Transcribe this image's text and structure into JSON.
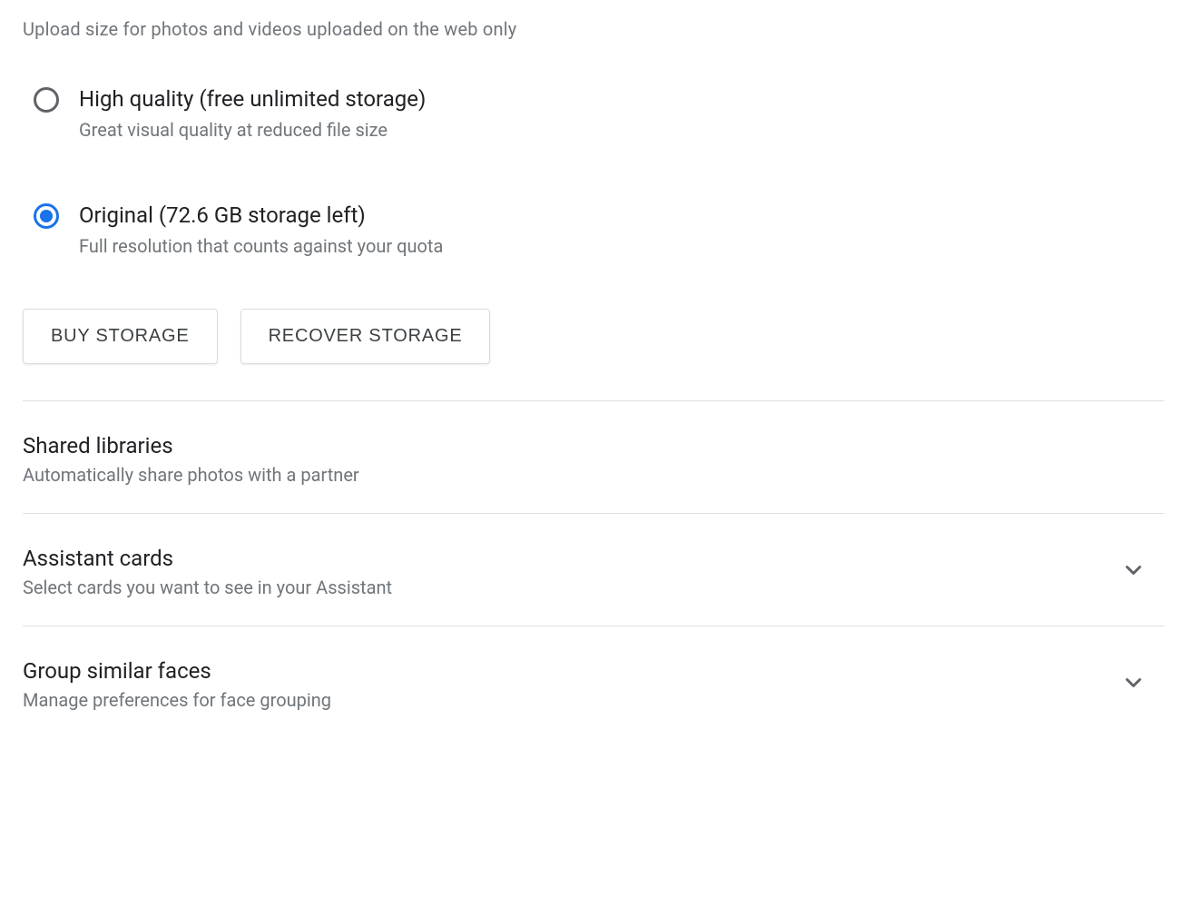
{
  "upload": {
    "header": "Upload size for photos and videos uploaded on the web only",
    "options": [
      {
        "title": "High quality (free unlimited storage)",
        "desc": "Great visual quality at reduced file size",
        "selected": false
      },
      {
        "title": "Original (72.6 GB storage left)",
        "desc": "Full resolution that counts against your quota",
        "selected": true
      }
    ],
    "buttons": {
      "buy": "BUY STORAGE",
      "recover": "RECOVER STORAGE"
    }
  },
  "sections": {
    "shared": {
      "title": "Shared libraries",
      "desc": "Automatically share photos with a partner"
    },
    "assistant": {
      "title": "Assistant cards",
      "desc": "Select cards you want to see in your Assistant"
    },
    "faces": {
      "title": "Group similar faces",
      "desc": "Manage preferences for face grouping"
    }
  }
}
